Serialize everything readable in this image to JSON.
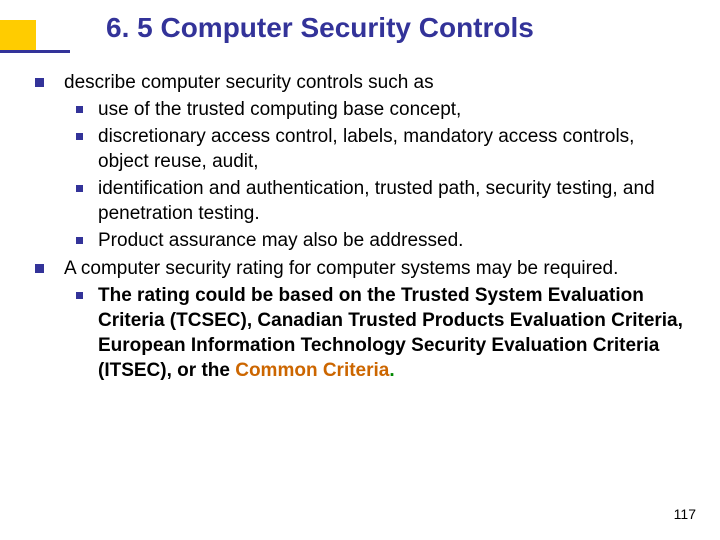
{
  "title": "6. 5 Computer Security Controls",
  "bullets": {
    "b1": "describe computer security controls such as",
    "b1_1": "use of the trusted computing base concept,",
    "b1_2": "discretionary access control, labels, mandatory access controls, object reuse, audit,",
    "b1_3": "identification and authentication, trusted path, security testing, and penetration testing.",
    "b1_4": "Product assurance may also be addressed.",
    "b2": "A computer security rating for computer systems may be required.",
    "b2_1a": "The rating could be based on the Trusted System Evaluation Criteria (TCSEC), Canadian Trusted Products Evaluation Criteria, European Information Technology Security Evaluation Criteria (ITSEC), or the ",
    "b2_1b": "Common Criteria",
    "b2_1c": "."
  },
  "pagenum": "117"
}
